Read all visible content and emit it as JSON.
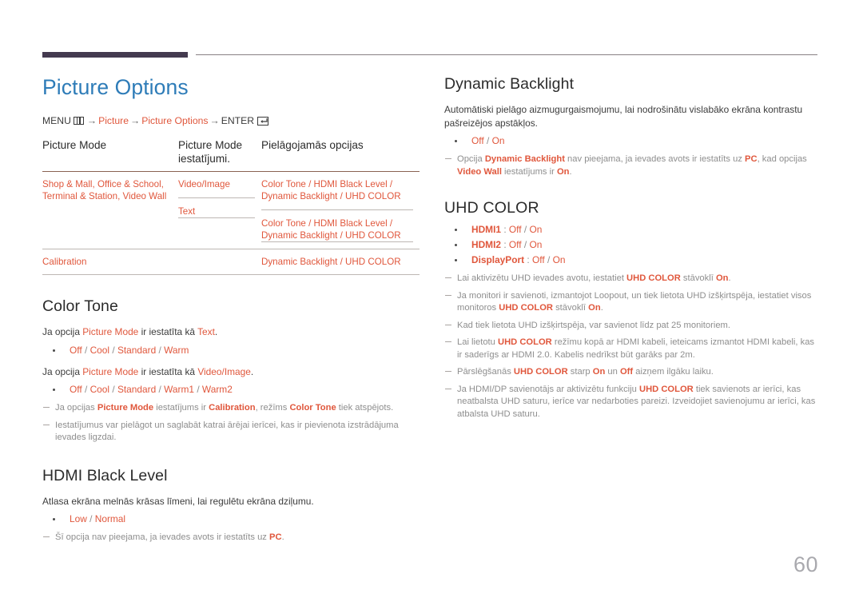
{
  "page": {
    "number": "60",
    "accent_blue": "#2e7cb8",
    "accent_orange": "#e0573c",
    "rule_dark": "#443a4f",
    "note_gray": "#8e8e8e"
  },
  "left": {
    "title": "Picture Options",
    "breadcrumb": {
      "menu_label": "MENU",
      "menu_icon": "menu-grid-icon",
      "arrow": "→",
      "item1": "Picture",
      "item2": "Picture Options",
      "enter_label": "ENTER",
      "enter_icon": "enter-key-icon"
    },
    "table": {
      "headers": [
        "Picture Mode",
        "Picture Mode iestatījumi.",
        "Pielāgojamās opcijas"
      ],
      "rows": [
        {
          "mode": "Shop & Mall, Office & School, Terminal & Station, Video Wall",
          "settings": [
            {
              "setting": "Video/Image",
              "options": "Color Tone / HDMI Black Level / Dynamic Backlight / UHD COLOR"
            },
            {
              "setting": "Text",
              "options": "Color Tone / HDMI Black Level / Dynamic Backlight / UHD COLOR"
            }
          ]
        },
        {
          "mode": "Calibration",
          "settings": [
            {
              "setting": "",
              "options": "Dynamic Backlight / UHD COLOR"
            }
          ]
        }
      ]
    },
    "color_tone": {
      "title": "Color Tone",
      "line1": "Ja opcija Picture Mode ir iestatīta kā Text.",
      "bullet1": "Off / Cool / Standard / Warm",
      "line2": "Ja opcija Picture Mode ir iestatīta kā Video/Image.",
      "bullet2": "Off / Cool / Standard / Warm1 / Warm2",
      "note1": "Ja opcijas Picture Mode iestatījums ir Calibration, režīms Color Tone tiek atspējots.",
      "note2": "Iestatījumus var pielāgot un saglabāt katrai ārējai ierīcei, kas ir pievienota izstrādājuma ievades ligzdai."
    },
    "hdmi_black_level": {
      "title": "HDMI Black Level",
      "description": "Atlasa ekrāna melnās krāsas līmeni, lai regulētu ekrāna dziļumu.",
      "bullet": "Low / Normal",
      "note": "Šī opcija nav pieejama, ja ievades avots ir iestatīts uz PC."
    }
  },
  "right": {
    "dynamic_backlight": {
      "title": "Dynamic Backlight",
      "description": "Automātiski pielāgo aizmugurgaismojumu, lai nodrošinātu vislabāko ekrāna kontrastu pašreizējos apstākļos.",
      "bullet": "Off / On",
      "note": "Opcija Dynamic Backlight nav pieejama, ja ievades avots ir iestatīts uz PC, kad opcijas Video Wall iestatījums ir On."
    },
    "uhd_color": {
      "title": "UHD COLOR",
      "bullets": [
        "HDMI1 : Off / On",
        "HDMI2 : Off / On",
        "DisplayPort : Off / On"
      ],
      "notes": [
        "Lai aktivizētu UHD ievades avotu, iestatiet UHD COLOR stāvoklī On.",
        "Ja monitori ir savienoti, izmantojot Loopout, un tiek lietota UHD izšķirtspēja, iestatiet visos monitoros UHD COLOR stāvoklī On.",
        "Kad tiek lietota UHD izšķirtspēja, var savienot līdz pat 25 monitoriem.",
        "Lai lietotu UHD COLOR režīmu kopā ar HDMI kabeli, ieteicams izmantot HDMI kabeli, kas ir saderīgs ar HDMI 2.0. Kabelis nedrīkst būt garāks par 2m.",
        "Pārslēgšanās UHD COLOR starp On un Off aizņem ilgāku laiku.",
        "Ja HDMI/DP savienotājs ar aktivizētu funkciju UHD COLOR tiek savienots ar ierīci, kas neatbalsta UHD saturu, ierīce var nedarboties pareizi. Izveidojiet savienojumu ar ierīci, kas atbalsta UHD saturu."
      ]
    }
  }
}
